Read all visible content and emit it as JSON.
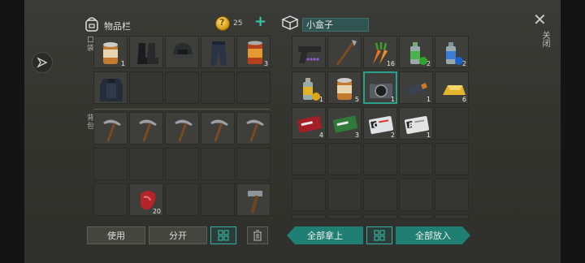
{
  "inventory": {
    "title": "物品栏",
    "coins": "25",
    "quick_label": "口袋",
    "backpack_label": "背包",
    "pocket_slots": [
      {
        "item": "canned-food",
        "qty": "1"
      },
      {
        "item": "boots",
        "qty": ""
      },
      {
        "item": "helmet",
        "qty": ""
      },
      {
        "item": "pants",
        "qty": ""
      },
      {
        "item": "canned-soup",
        "qty": "3"
      },
      {
        "item": "body-armor",
        "qty": ""
      }
    ],
    "backpack_slots": [
      {
        "item": "pickaxe",
        "qty": ""
      },
      {
        "item": "pickaxe",
        "qty": ""
      },
      {
        "item": "pickaxe",
        "qty": ""
      },
      {
        "item": "pickaxe",
        "qty": ""
      },
      {
        "item": "pickaxe",
        "qty": ""
      },
      {
        "item": "raw-meat",
        "qty": "20"
      },
      {
        "item": "hammer",
        "qty": ""
      }
    ],
    "buttons": {
      "use": "使用",
      "split": "分开"
    }
  },
  "container": {
    "title": "小盒子",
    "close_label": "关闭",
    "slots": [
      {
        "item": "pistol",
        "qty": ""
      },
      {
        "item": "spear",
        "qty": ""
      },
      {
        "item": "carrots",
        "qty": "16"
      },
      {
        "item": "spray-can-green",
        "qty": "2"
      },
      {
        "item": "spray-can-blue",
        "qty": "2"
      },
      {
        "item": "spray-can-yellow",
        "qty": "1"
      },
      {
        "item": "canned-food",
        "qty": "5"
      },
      {
        "item": "camera",
        "qty": "1"
      },
      {
        "item": "usb-drive",
        "qty": "1"
      },
      {
        "item": "gold-bar",
        "qty": "6"
      },
      {
        "item": "red-coupon",
        "qty": "4"
      },
      {
        "item": "green-coupon",
        "qty": "3"
      },
      {
        "item": "card-c",
        "qty": "2"
      },
      {
        "item": "card-r",
        "qty": "1"
      }
    ],
    "buttons": {
      "take_all": "全部拿上",
      "put_all": "全部放入"
    }
  },
  "colors": {
    "accent": "#1f7f72",
    "accent_border": "#35b19f",
    "slot_bg": "#3e3e3a"
  }
}
